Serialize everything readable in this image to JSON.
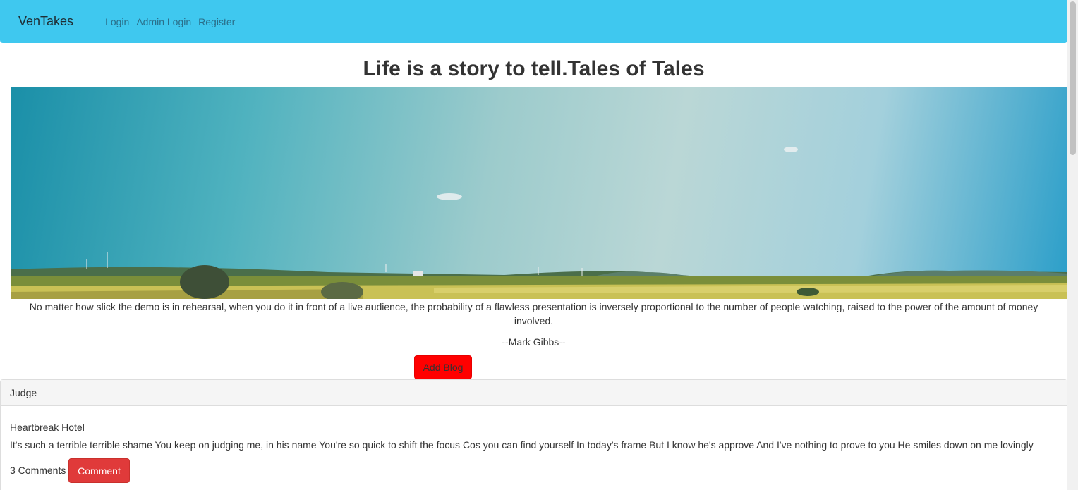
{
  "navbar": {
    "brand": "VenTakes",
    "links": [
      "Login",
      "Admin Login",
      "Register"
    ],
    "background_color": "#3fc8ef"
  },
  "hero": {
    "heading": "Life is a story to tell.Tales of Tales",
    "banner_image": "landscape-wheat-field-sky"
  },
  "quote": {
    "text": "No matter how slick the demo is in rehearsal, when you do it in front of a live audience, the probability of a flawless presentation is inversely proportional to the number of people watching, raised to the power of the amount of money involved.",
    "author": "--Mark Gibbs--"
  },
  "actions": {
    "add_blog_label": "Add Blog",
    "add_blog_color": "#ff0000"
  },
  "blog": {
    "category": "Judge",
    "title": "Heartbreak Hotel",
    "body": "It's such a terrible terrible shame You keep on judging me, in his name You're so quick to shift the focus Cos you can find yourself In today's frame But I know he's approve And I've nothing to prove to you He smiles down on me lovingly",
    "comments_count": "3 Comments",
    "comment_button_label": "Comment",
    "comment_button_color": "#e03a3a"
  }
}
